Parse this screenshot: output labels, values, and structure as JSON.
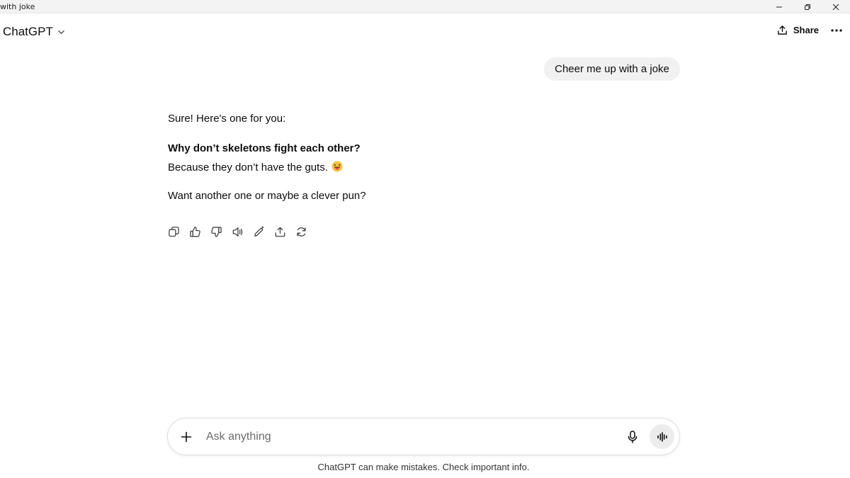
{
  "window": {
    "title": "with joke",
    "minimize_icon": "minimize-icon",
    "restore_icon": "restore-icon",
    "close_icon": "close-icon"
  },
  "header": {
    "model_label": "ChatGPT",
    "model_icon": "chevron-down-icon",
    "share_label": "Share",
    "share_icon": "share-icon",
    "more_icon": "more-dots-icon"
  },
  "conversation": {
    "user_message": "Cheer me up with a joke",
    "assistant": {
      "intro": "Sure! Here's one for you:",
      "question": "Why don’t skeletons fight each other?",
      "answer": "Because they don’t have the guts.",
      "answer_emoji": "grinning-tongue-emoji",
      "followup": "Want another one or maybe a clever pun?"
    },
    "actions": [
      {
        "name": "copy-button",
        "icon": "copy-icon"
      },
      {
        "name": "thumbs-up-button",
        "icon": "thumbs-up-icon"
      },
      {
        "name": "thumbs-down-button",
        "icon": "thumbs-down-icon"
      },
      {
        "name": "read-aloud-button",
        "icon": "speaker-icon"
      },
      {
        "name": "edit-button",
        "icon": "pencil-sparkle-icon"
      },
      {
        "name": "share-message-button",
        "icon": "upload-icon"
      },
      {
        "name": "regenerate-button",
        "icon": "refresh-icon"
      }
    ]
  },
  "composer": {
    "placeholder": "Ask anything",
    "value": "",
    "plus_icon": "plus-icon",
    "mic_icon": "microphone-icon",
    "voice_icon": "voice-wave-icon"
  },
  "footer": {
    "disclaimer": "ChatGPT can make mistakes. Check important info."
  },
  "colors": {
    "user_bubble": "#f1f1f1",
    "text": "#0d0d0d",
    "voice_button_bg": "#ececec"
  }
}
